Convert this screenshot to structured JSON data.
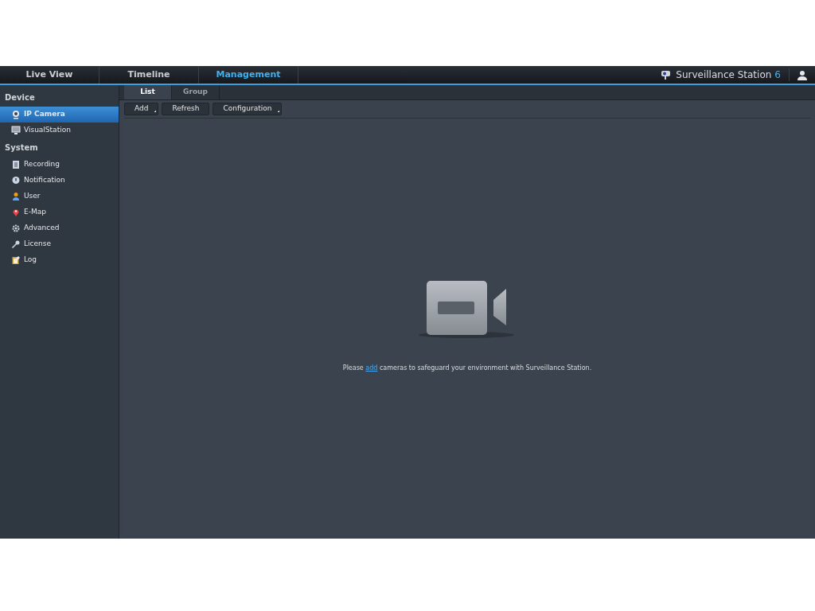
{
  "nav": {
    "tabs": [
      {
        "label": "Live View",
        "selected": false
      },
      {
        "label": "Timeline",
        "selected": false
      },
      {
        "label": "Management",
        "selected": true
      }
    ],
    "brand": {
      "name": "Surveillance Station",
      "version": "6"
    }
  },
  "sidebar": {
    "sections": [
      {
        "title": "Device",
        "items": [
          {
            "label": "IP Camera",
            "selected": true
          },
          {
            "label": "VisualStation",
            "selected": false
          }
        ]
      },
      {
        "title": "System",
        "items": [
          {
            "label": "Recording",
            "selected": false
          },
          {
            "label": "Notification",
            "selected": false
          },
          {
            "label": "User",
            "selected": false
          },
          {
            "label": "E-Map",
            "selected": false
          },
          {
            "label": "Advanced",
            "selected": false
          },
          {
            "label": "License",
            "selected": false
          },
          {
            "label": "Log",
            "selected": false
          }
        ]
      }
    ]
  },
  "tabs": [
    {
      "label": "List",
      "selected": true
    },
    {
      "label": "Group",
      "selected": false
    }
  ],
  "toolbar": [
    {
      "label": "Add",
      "dropdown": true
    },
    {
      "label": "Refresh",
      "dropdown": false
    },
    {
      "label": "Configuration",
      "dropdown": true
    }
  ],
  "empty_state": {
    "before": "Please",
    "link": "add",
    "after": "cameras to safeguard your environment with Surveillance Station."
  }
}
